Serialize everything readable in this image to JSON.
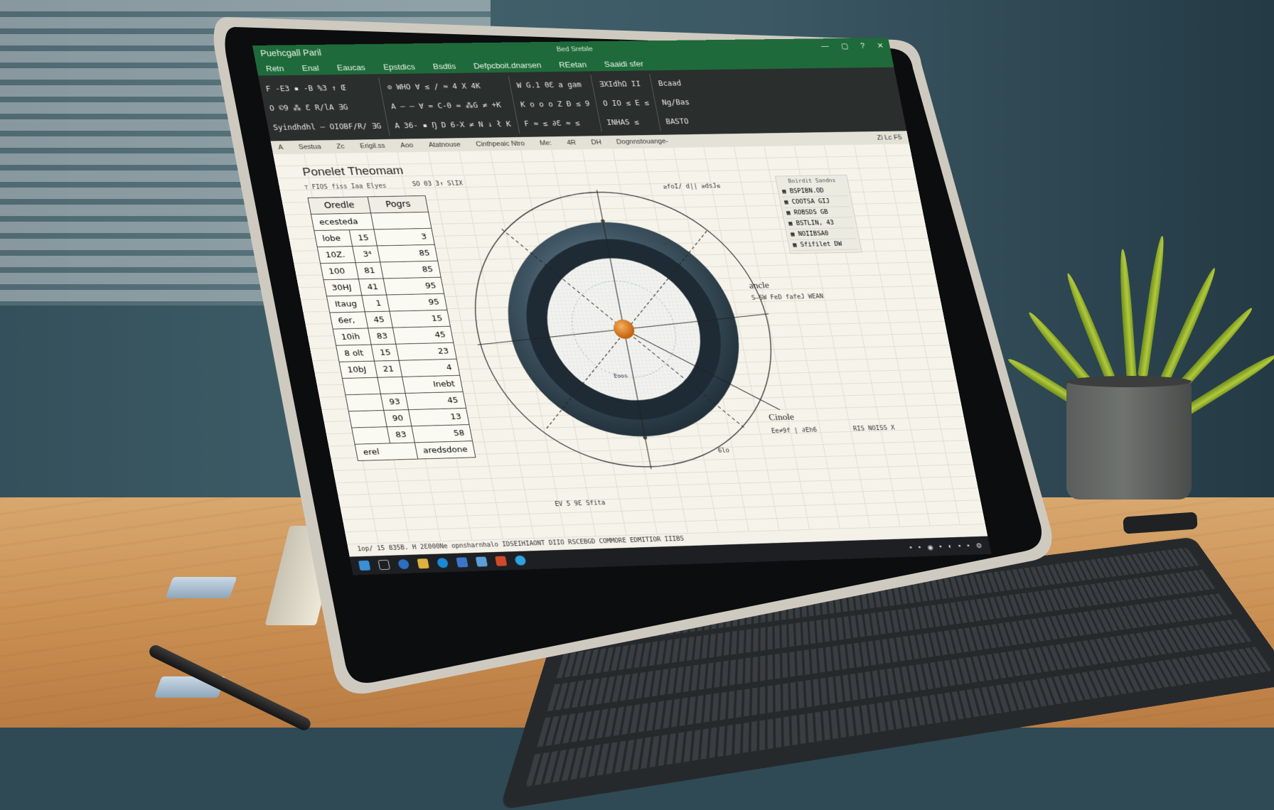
{
  "app": {
    "window_title": "Puehcgall Paril",
    "document_name": "Bed Srebile",
    "window_controls": [
      "—",
      "▢",
      "?",
      "✕"
    ]
  },
  "menu": [
    "Retn",
    "Enal",
    "Eaucas",
    "Epstdics",
    "Bsdtis",
    "Defpcboit.dnarsen",
    "REetan",
    "Saaidi sfer"
  ],
  "ribbon": {
    "groups": [
      [
        "F  -E3  ▪  -B %3 ↑ Œ",
        "O  ©9  ⁂ Ɛ  R/lA  ƎG",
        "Syindhdhl  —  OIOBF/R/ ƎG"
      ],
      [
        "⊙  WHO   ∀   ≤   /  ≈  4  X  4K",
        "A  — — ∀  = C-0  =  ⁂G  ≠  +K",
        "A  36-  ▪  Ŋ  D 6-X  ≠  N  ↓ ł K"
      ],
      [
        "W G.1 0Ɛ a  gam",
        "K  o  o  o  Z  Ð  ≤ 9",
        "F  ≈  ≤  ∂Ɛ  ≈  ≤"
      ],
      [
        "ƎXIdhΩ  II",
        "O IO ≤  E  ≤",
        "INHAS  ≤"
      ],
      [
        "Bcaad",
        "Ng/Bas",
        "BASTO"
      ]
    ]
  },
  "name_bar": [
    "A",
    "Sestua",
    "Zc",
    "Erigil.ss",
    "Aoo",
    "Atatnouse",
    "Cinthpeaic Ntro",
    "Me:",
    "4R",
    "DH",
    "Dognnstouange-",
    "Zi  Lc F5"
  ],
  "sheet": {
    "title": "Ponelet Theomam",
    "subtitle": "⊤  FIOS  fiss  Iaa  Elyes",
    "table": {
      "headers": [
        "Oredle",
        "Pogrs"
      ],
      "subheader": "ecesteda",
      "rows": [
        [
          "lobe",
          "15",
          "3"
        ],
        [
          "10Z.",
          "3⁴",
          "85"
        ],
        [
          "100",
          "81",
          "85"
        ],
        [
          "30HJ",
          "41",
          "95"
        ],
        [
          "Itaug",
          "1",
          "95"
        ],
        [
          "6er,",
          "45",
          "15"
        ],
        [
          "10ih",
          "83",
          "45"
        ],
        [
          "8 olt",
          "15",
          "23"
        ],
        [
          "10bJ",
          "21",
          "4"
        ]
      ],
      "lower_header": "Inebt",
      "lower_rows": [
        [
          "93",
          "45"
        ],
        [
          "90",
          "13"
        ],
        [
          "83",
          "58"
        ]
      ],
      "footer": [
        "erel",
        "aredsdone"
      ]
    },
    "side_panel": {
      "header": "Boirdit\nSandns",
      "items": [
        "BSPIBN.OD",
        "COOTSA GIJ",
        "ROBSDS GB",
        "BSTLIN, 43",
        "NOIIBSA0",
        "Sfifilet DW"
      ]
    },
    "annotations": {
      "angle_label": "ancle",
      "angle_note": "S—SW FeD fafeJ WEAN",
      "circle_label": "Cinole",
      "circle_note": "Ee≠9f | ∂Eh6",
      "inner_text": "Eoos",
      "top_note": "SO 03 3↑ SlIX",
      "right_note": "≥foI/ d|| ≥dsJ≤",
      "bottom_note": "EV 5 9Ɛ  Sfita",
      "right_bottom": "RIS  NOISS  X",
      "mid_note": "6lo"
    },
    "status_text": "1op/ 15  835B.  H 2Ɛ000Ne  opnsharnhalo  IDSEIHIAONT DIIO RSCEBGD COMMORE EDMITIOR IIIBS"
  },
  "colors": {
    "ribbon_green": "#1f6a3a",
    "ribbon_dark": "#2a2e2d",
    "ring_outer": "#3f5563",
    "ring_inner": "#1e2b34",
    "center_dot": "#d8761c"
  },
  "taskbar": {
    "icons": [
      "windows-icon",
      "task-view-icon",
      "browser-icon",
      "folder-icon",
      "edge-icon",
      "mail-icon",
      "store-icon",
      "office-icon",
      "chrome-icon"
    ],
    "tray_count": 8
  }
}
